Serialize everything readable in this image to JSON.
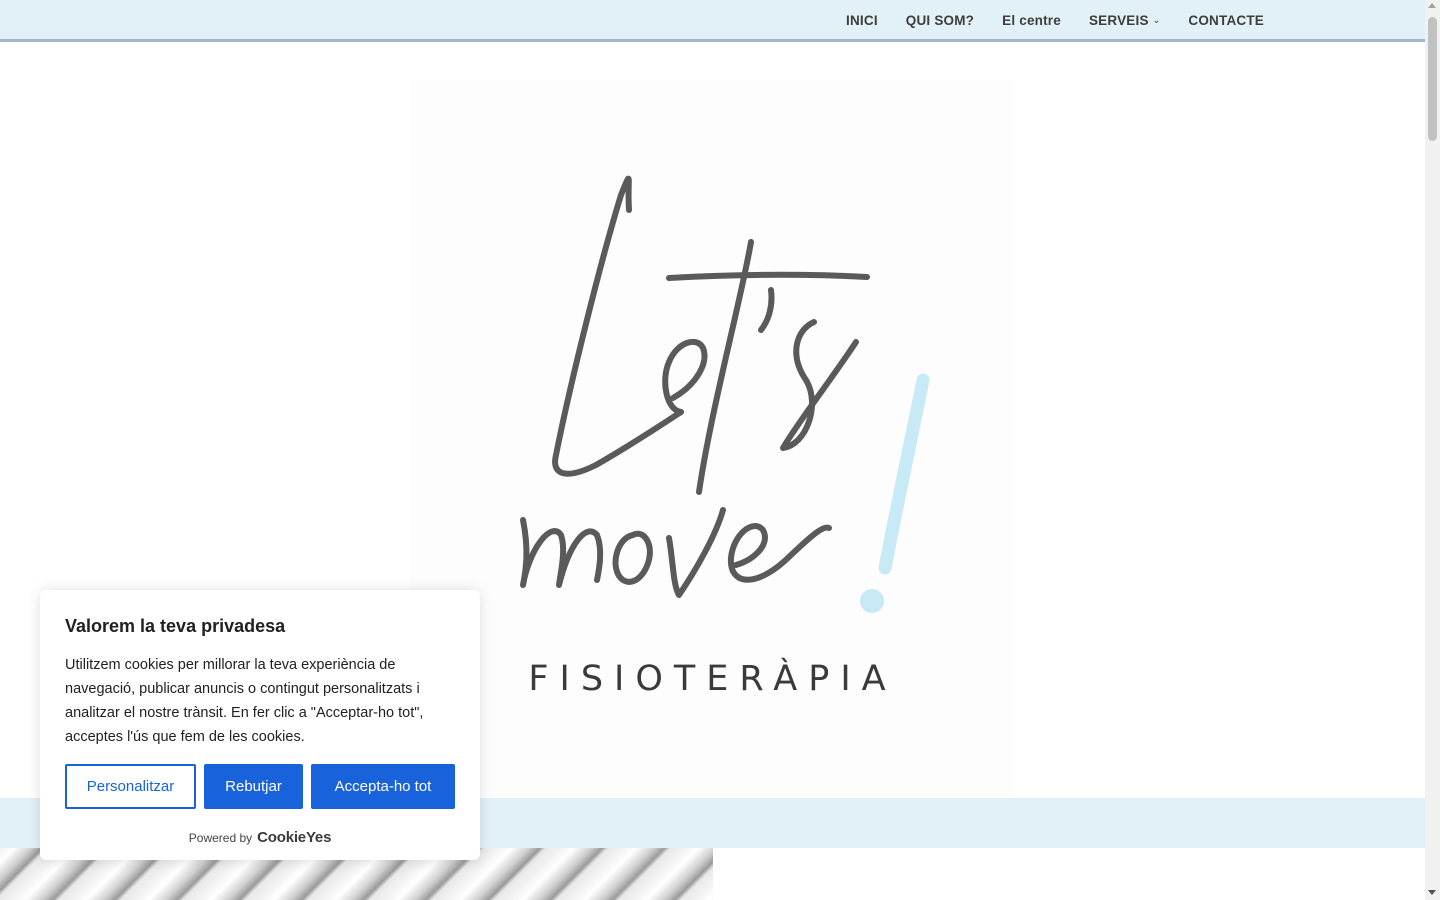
{
  "nav": {
    "items": [
      {
        "label": "INICI"
      },
      {
        "label": "QUI SOM?"
      },
      {
        "label": "El centre"
      },
      {
        "label": "SERVEIS",
        "has_dropdown": true
      },
      {
        "label": "CONTACTE"
      }
    ]
  },
  "hero": {
    "logo_script_line1": "Let's",
    "logo_script_line2": "move",
    "logo_exclamation": "!",
    "logo_word": "FISIOTERÀPIA",
    "logo_color": "#5a5a5a",
    "exclamation_color": "#c8e9f6"
  },
  "cookie": {
    "title": "Valorem la teva privadesa",
    "text": "Utilitzem cookies per millorar la teva experiència de navegació, publicar anuncis o contingut personalitzats i analitzar el nostre trànsit. En fer clic a \"Acceptar-ho tot\", acceptes l'ús que fem de les cookies.",
    "customize_label": "Personalitzar",
    "reject_label": "Rebutjar",
    "accept_label": "Accepta-ho tot",
    "powered_by": "Powered by",
    "powered_brand": "CookieYes",
    "accent": "#1863dc"
  },
  "colors": {
    "nav_bg": "#e2f1f7",
    "band_bg": "#e2f1f7"
  }
}
